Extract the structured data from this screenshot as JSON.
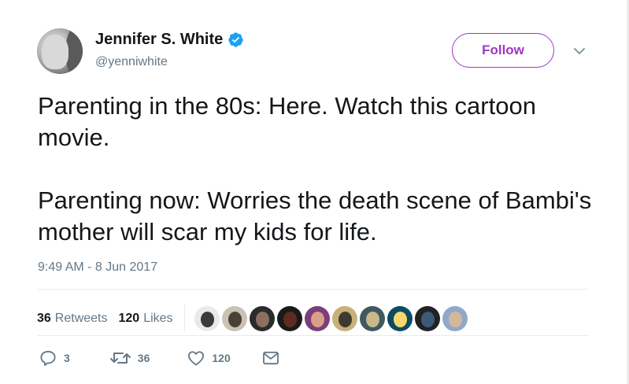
{
  "user": {
    "name": "Jennifer S. White",
    "handle": "@yenniwhite",
    "verified": true
  },
  "follow_button": {
    "label": "Follow",
    "accent": "#a035c6"
  },
  "tweet": {
    "text": "Parenting in the 80s: Here. Watch this cartoon movie.\n\nParenting now: Worries the death scene of Bambi's mother will scar my kids for life.",
    "timestamp": "9:49 AM - 8 Jun 2017"
  },
  "stats": {
    "retweets": {
      "count": "36",
      "label": "Retweets"
    },
    "likes": {
      "count": "120",
      "label": "Likes"
    }
  },
  "likers": [
    {
      "name": "liker-1",
      "colors": [
        "#e9e9e9",
        "#3a3a3a"
      ]
    },
    {
      "name": "liker-2",
      "colors": [
        "#c9c2b5",
        "#4a4033"
      ]
    },
    {
      "name": "liker-3",
      "colors": [
        "#2b2b2b",
        "#8a7060"
      ]
    },
    {
      "name": "liker-4",
      "colors": [
        "#1a1a1a",
        "#5e2b1f"
      ]
    },
    {
      "name": "liker-5",
      "colors": [
        "#7d3d7a",
        "#d6a188"
      ]
    },
    {
      "name": "liker-6",
      "colors": [
        "#c7b07a",
        "#3d3a2e"
      ]
    },
    {
      "name": "liker-7",
      "colors": [
        "#3f5960",
        "#c9b98a"
      ]
    },
    {
      "name": "liker-8",
      "colors": [
        "#0d4b63",
        "#f5d76e"
      ]
    },
    {
      "name": "liker-9",
      "colors": [
        "#222222",
        "#3b5a7a"
      ]
    },
    {
      "name": "liker-10",
      "colors": [
        "#8fa9c9",
        "#d4b89a"
      ]
    }
  ],
  "actions": {
    "reply": {
      "icon": "reply-icon",
      "count": "3"
    },
    "retweet": {
      "icon": "retweet-icon",
      "count": "36"
    },
    "like": {
      "icon": "heart-icon",
      "count": "120"
    },
    "message": {
      "icon": "envelope-icon"
    }
  },
  "colors": {
    "verified_badge": "#1da1f2",
    "secondary_text": "#657786",
    "divider": "#e6ecf0"
  }
}
